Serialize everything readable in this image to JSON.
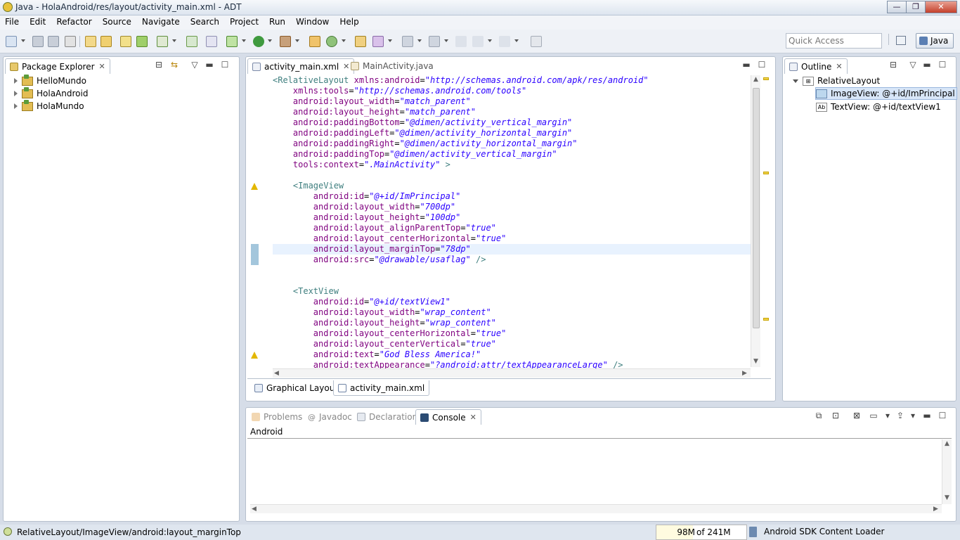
{
  "window": {
    "title": "Java - HolaAndroid/res/layout/activity_main.xml - ADT",
    "buttons": {
      "minimize": "—",
      "maximize": "❐",
      "close": "✕"
    }
  },
  "menu": [
    "File",
    "Edit",
    "Refactor",
    "Source",
    "Navigate",
    "Search",
    "Project",
    "Run",
    "Window",
    "Help"
  ],
  "toolbar": {
    "quick_access_placeholder": "Quick Access",
    "perspective": "Java"
  },
  "package_explorer": {
    "title": "Package Explorer",
    "projects": [
      "HelloMundo",
      "HolaAndroid",
      "HolaMundo"
    ]
  },
  "editor": {
    "tabs": [
      {
        "label": "activity_main.xml",
        "active": true
      },
      {
        "label": "MainActivity.java",
        "active": false
      }
    ],
    "lines": [
      [
        [
          "t",
          "<RelativeLayout "
        ],
        [
          "a",
          "xmlns:android"
        ],
        [
          "p",
          "="
        ],
        [
          "v",
          "\"http://schemas.android.com/apk/res/android\""
        ]
      ],
      [
        [
          "p",
          "    "
        ],
        [
          "a",
          "xmlns:tools"
        ],
        [
          "p",
          "="
        ],
        [
          "v",
          "\"http://schemas.android.com/tools\""
        ]
      ],
      [
        [
          "p",
          "    "
        ],
        [
          "a",
          "android:layout_width"
        ],
        [
          "p",
          "="
        ],
        [
          "v",
          "\"match_parent\""
        ]
      ],
      [
        [
          "p",
          "    "
        ],
        [
          "a",
          "android:layout_height"
        ],
        [
          "p",
          "="
        ],
        [
          "v",
          "\"match_parent\""
        ]
      ],
      [
        [
          "p",
          "    "
        ],
        [
          "a",
          "android:paddingBottom"
        ],
        [
          "p",
          "="
        ],
        [
          "v",
          "\"@dimen/activity_vertical_margin\""
        ]
      ],
      [
        [
          "p",
          "    "
        ],
        [
          "a",
          "android:paddingLeft"
        ],
        [
          "p",
          "="
        ],
        [
          "v",
          "\"@dimen/activity_horizontal_margin\""
        ]
      ],
      [
        [
          "p",
          "    "
        ],
        [
          "a",
          "android:paddingRight"
        ],
        [
          "p",
          "="
        ],
        [
          "v",
          "\"@dimen/activity_horizontal_margin\""
        ]
      ],
      [
        [
          "p",
          "    "
        ],
        [
          "a",
          "android:paddingTop"
        ],
        [
          "p",
          "="
        ],
        [
          "v",
          "\"@dimen/activity_vertical_margin\""
        ]
      ],
      [
        [
          "p",
          "    "
        ],
        [
          "a",
          "tools:context"
        ],
        [
          "p",
          "="
        ],
        [
          "v",
          "\".MainActivity\""
        ],
        [
          "t",
          " >"
        ]
      ],
      [
        [
          "p",
          ""
        ]
      ],
      [
        [
          "p",
          "    "
        ],
        [
          "t",
          "<ImageView"
        ]
      ],
      [
        [
          "p",
          "        "
        ],
        [
          "a",
          "android:id"
        ],
        [
          "p",
          "="
        ],
        [
          "v",
          "\"@+id/ImPrincipal\""
        ]
      ],
      [
        [
          "p",
          "        "
        ],
        [
          "a",
          "android:layout_width"
        ],
        [
          "p",
          "="
        ],
        [
          "v",
          "\"700dp\""
        ]
      ],
      [
        [
          "p",
          "        "
        ],
        [
          "a",
          "android:layout_height"
        ],
        [
          "p",
          "="
        ],
        [
          "v",
          "\"100dp\""
        ]
      ],
      [
        [
          "p",
          "        "
        ],
        [
          "a",
          "android:layout_alignParentTop"
        ],
        [
          "p",
          "="
        ],
        [
          "v",
          "\"true\""
        ]
      ],
      [
        [
          "p",
          "        "
        ],
        [
          "a",
          "android:layout_centerHorizontal"
        ],
        [
          "p",
          "="
        ],
        [
          "v",
          "\"true\""
        ]
      ],
      [
        [
          "p",
          "        "
        ],
        [
          "a",
          "android:layout_marginTop"
        ],
        [
          "p",
          "="
        ],
        [
          "v",
          "\"78dp\""
        ]
      ],
      [
        [
          "p",
          "        "
        ],
        [
          "a",
          "android:src"
        ],
        [
          "p",
          "="
        ],
        [
          "v",
          "\"@drawable/usaflag\""
        ],
        [
          "t",
          " />"
        ]
      ],
      [
        [
          "p",
          ""
        ]
      ],
      [
        [
          "p",
          ""
        ]
      ],
      [
        [
          "p",
          "    "
        ],
        [
          "t",
          "<TextView"
        ]
      ],
      [
        [
          "p",
          "        "
        ],
        [
          "a",
          "android:id"
        ],
        [
          "p",
          "="
        ],
        [
          "v",
          "\"@+id/textView1\""
        ]
      ],
      [
        [
          "p",
          "        "
        ],
        [
          "a",
          "android:layout_width"
        ],
        [
          "p",
          "="
        ],
        [
          "v",
          "\"wrap_content\""
        ]
      ],
      [
        [
          "p",
          "        "
        ],
        [
          "a",
          "android:layout_height"
        ],
        [
          "p",
          "="
        ],
        [
          "v",
          "\"wrap_content\""
        ]
      ],
      [
        [
          "p",
          "        "
        ],
        [
          "a",
          "android:layout_centerHorizontal"
        ],
        [
          "p",
          "="
        ],
        [
          "v",
          "\"true\""
        ]
      ],
      [
        [
          "p",
          "        "
        ],
        [
          "a",
          "android:layout_centerVertical"
        ],
        [
          "p",
          "="
        ],
        [
          "v",
          "\"true\""
        ]
      ],
      [
        [
          "p",
          "        "
        ],
        [
          "a",
          "android:text"
        ],
        [
          "p",
          "="
        ],
        [
          "v",
          "\"God Bless America!\""
        ]
      ],
      [
        [
          "p",
          "        "
        ],
        [
          "a",
          "android:textAppearance"
        ],
        [
          "p",
          "="
        ],
        [
          "v",
          "\"?android:attr/textAppearanceLarge\""
        ],
        [
          "t",
          " />"
        ]
      ]
    ],
    "bottom_tabs": [
      {
        "label": "Graphical Layout",
        "active": false
      },
      {
        "label": "activity_main.xml",
        "active": true
      }
    ]
  },
  "outline": {
    "title": "Outline",
    "root": "RelativeLayout",
    "children": [
      "ImageView: @+id/ImPrincipal",
      "TextView: @+id/textView1"
    ]
  },
  "console": {
    "tabs": [
      "Problems",
      "Javadoc",
      "Declaration",
      "Console"
    ],
    "active_tab": "Console",
    "name": "Android"
  },
  "status": {
    "path": "RelativeLayout/ImageView/android:layout_marginTop",
    "heap_used": "98M",
    "heap_total": "of 241M",
    "heap_fraction": 0.41,
    "loader": "Android SDK Content Loader"
  }
}
